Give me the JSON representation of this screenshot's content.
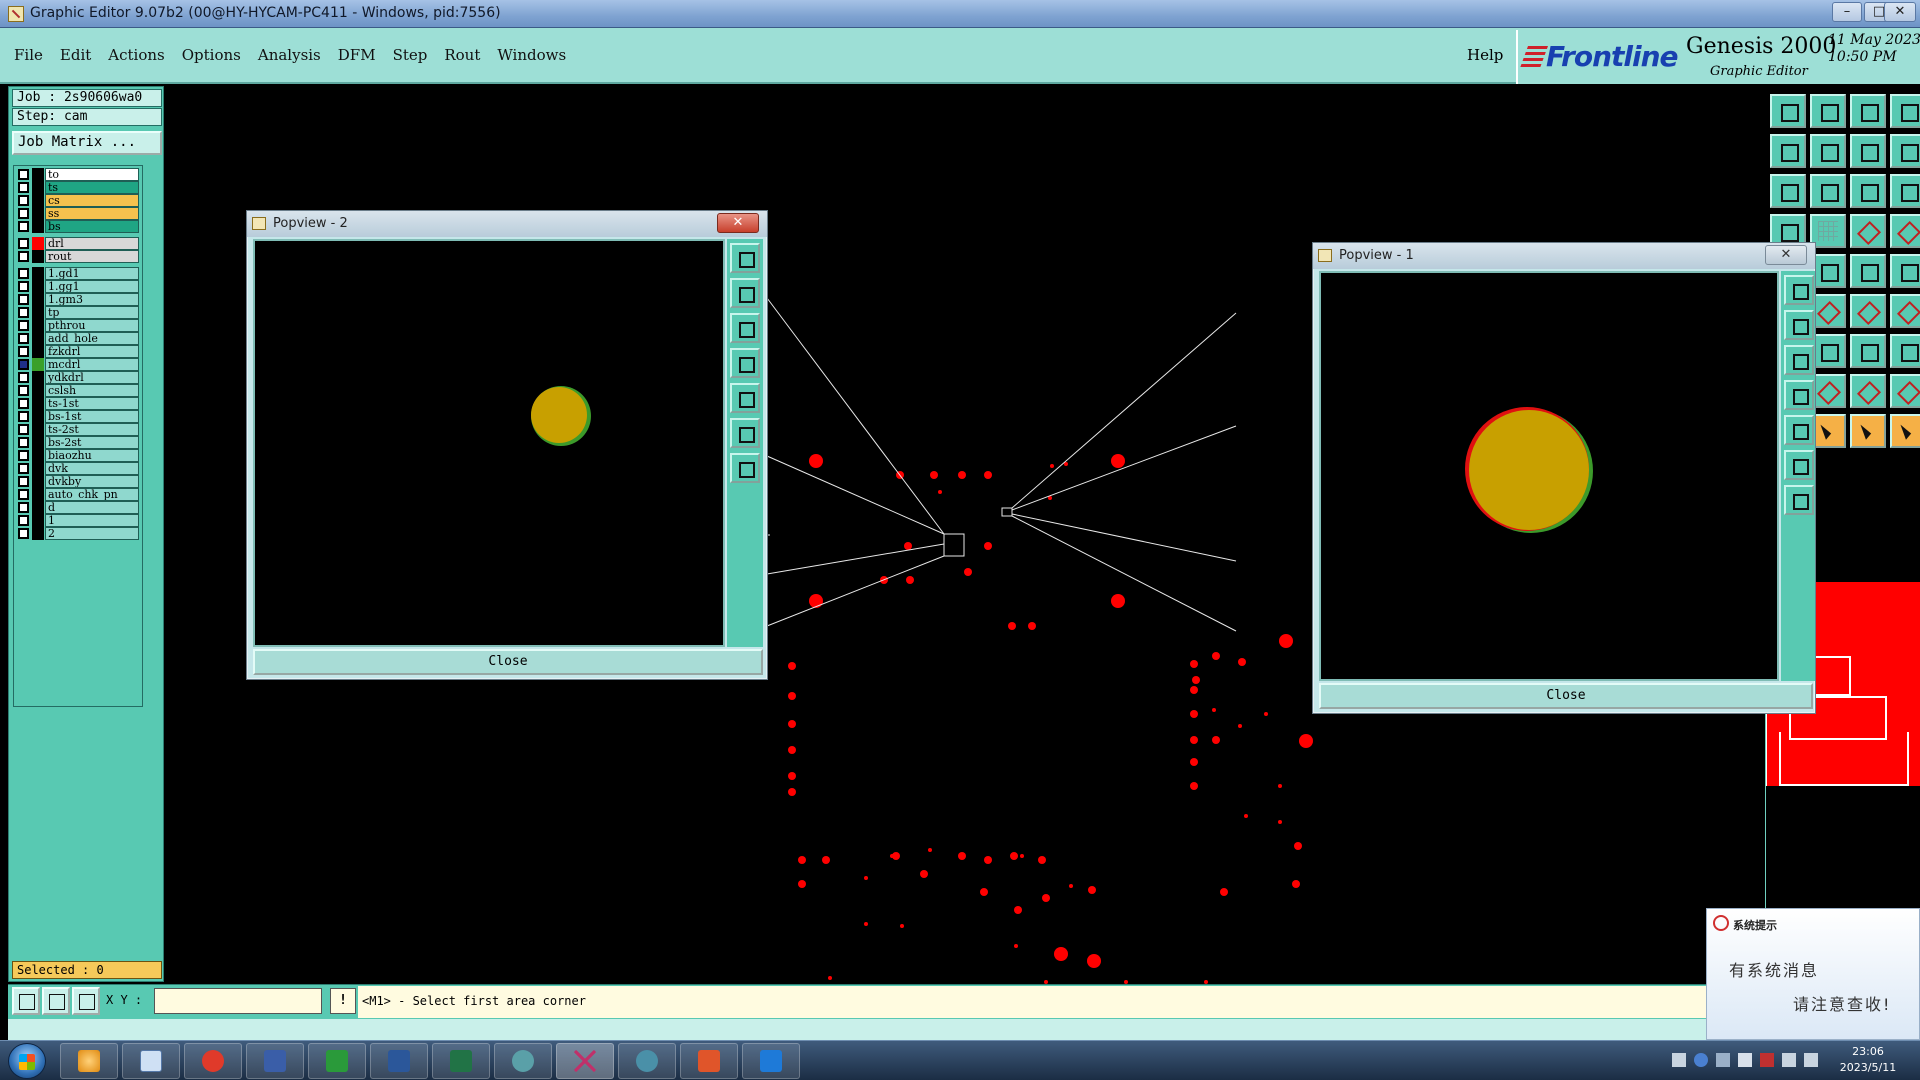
{
  "window": {
    "title": "Graphic Editor 9.07b2 (00@HY-HYCAM-PC411 - Windows, pid:7556)",
    "controls": [
      "–",
      "□",
      "✕"
    ]
  },
  "menu": {
    "items": [
      "File",
      "Edit",
      "Actions",
      "Options",
      "Analysis",
      "DFM",
      "Step",
      "Rout",
      "Windows"
    ],
    "help": "Help"
  },
  "brand": {
    "logo": "Frontline",
    "product": "Genesis 2000",
    "subtitle": "Graphic Editor",
    "date": "11 May 2023",
    "time": "10:50 PM"
  },
  "left_panel": {
    "job": "Job : 2s90606wa0",
    "step": "Step: cam",
    "job_matrix": "Job Matrix ...",
    "selected": "Selected : 0",
    "layers": [
      {
        "name": "to",
        "color": "#000000",
        "bg": "#ffffff"
      },
      {
        "name": "ts",
        "color": "#000000",
        "bg": "#1fa584"
      },
      {
        "name": "cs",
        "color": "#000000",
        "bg": "#f5c24e"
      },
      {
        "name": "ss",
        "color": "#000000",
        "bg": "#f5c24e"
      },
      {
        "name": "bs",
        "color": "#000000",
        "bg": "#1fa584"
      },
      {
        "name": "drl",
        "color": "#ff0000",
        "bg": "#d8d8d8"
      },
      {
        "name": "rout",
        "color": "#000000",
        "bg": "#d8d8d8"
      },
      {
        "name": "1.gd1",
        "color": "#000000",
        "bg": "#8fd8ce"
      },
      {
        "name": "1.gg1",
        "color": "#000000",
        "bg": "#8fd8ce"
      },
      {
        "name": "1.gm3",
        "color": "#000000",
        "bg": "#8fd8ce"
      },
      {
        "name": "tp",
        "color": "#000000",
        "bg": "#8fd8ce"
      },
      {
        "name": "pthrou",
        "color": "#000000",
        "bg": "#8fd8ce"
      },
      {
        "name": "add_hole",
        "color": "#000000",
        "bg": "#8fd8ce"
      },
      {
        "name": "fzkdrl",
        "color": "#000000",
        "bg": "#8fd8ce"
      },
      {
        "name": "mcdrl",
        "color": "#3aa02a",
        "bg": "#8fd8ce"
      },
      {
        "name": "ydkdrl",
        "color": "#000000",
        "bg": "#8fd8ce"
      },
      {
        "name": "cslsh",
        "color": "#000000",
        "bg": "#8fd8ce"
      },
      {
        "name": "ts-1st",
        "color": "#000000",
        "bg": "#8fd8ce"
      },
      {
        "name": "bs-1st",
        "color": "#000000",
        "bg": "#8fd8ce"
      },
      {
        "name": "ts-2st",
        "color": "#000000",
        "bg": "#8fd8ce"
      },
      {
        "name": "bs-2st",
        "color": "#000000",
        "bg": "#8fd8ce"
      },
      {
        "name": "biaozhu",
        "color": "#000000",
        "bg": "#8fd8ce"
      },
      {
        "name": "dvk",
        "color": "#000000",
        "bg": "#8fd8ce"
      },
      {
        "name": "dvkby",
        "color": "#000000",
        "bg": "#8fd8ce"
      },
      {
        "name": "auto_chk_pn",
        "color": "#000000",
        "bg": "#8fd8ce"
      },
      {
        "name": "d",
        "color": "#000000",
        "bg": "#8fd8ce"
      },
      {
        "name": "1",
        "color": "#000000",
        "bg": "#8fd8ce"
      },
      {
        "name": "2",
        "color": "#000000",
        "bg": "#8fd8ce"
      }
    ]
  },
  "popview2": {
    "title": "Popview - 2",
    "close_label": "Close",
    "close_x": "✕"
  },
  "popview1": {
    "title": "Popview - 1",
    "close_label": "Close",
    "close_x": "✕"
  },
  "command_bar": {
    "xy_label": "X Y :",
    "xy_value": "",
    "cmd_icon": "!",
    "prompt": "<M1> - Select first area corner"
  },
  "notification": {
    "header": "系统提示",
    "line1": "有系统消息",
    "line2": "请注意查收!"
  },
  "taskbar": {
    "time": "23:06",
    "date": "2023/5/11"
  },
  "colors": {
    "panel": "#58c9b2",
    "menubar": "#9ddfd6",
    "drill": "#ff0000",
    "pad": "#c8a000"
  }
}
